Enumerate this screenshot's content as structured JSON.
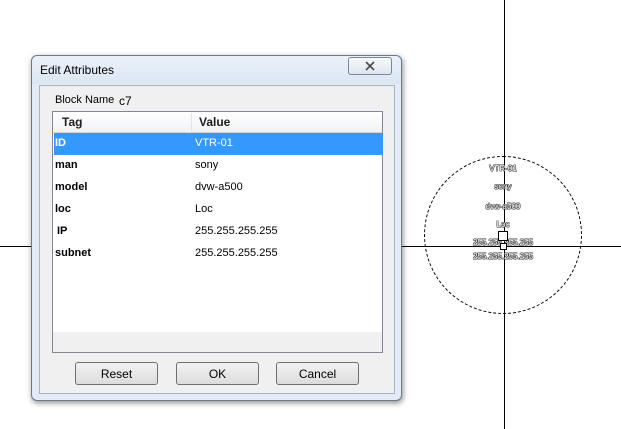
{
  "dialog": {
    "title": "Edit Attributes",
    "close_icon": "close-icon",
    "block_name_label": "Block Name",
    "block_name_value": "c7",
    "columns": {
      "tag": "Tag",
      "value": "Value"
    },
    "rows": [
      {
        "tag": "ID",
        "value": "VTR-01",
        "selected": true
      },
      {
        "tag": "man",
        "value": "sony",
        "selected": false
      },
      {
        "tag": "model",
        "value": "dvw-a500",
        "selected": false
      },
      {
        "tag": "loc",
        "value": "Loc",
        "selected": false
      },
      {
        "tag": "IP",
        "value": "255.255.255.255",
        "selected": false
      },
      {
        "tag": "subnet",
        "value": "255.255.255.255",
        "selected": false
      }
    ],
    "buttons": {
      "reset": "Reset",
      "ok": "OK",
      "cancel": "Cancel"
    },
    "selection_color": "#3399ff"
  },
  "drawing": {
    "block_attributes": [
      "VTR-01",
      "sony",
      "dvw-a500",
      "Loc",
      "255.255.255.255",
      "255.255.255.255"
    ]
  }
}
